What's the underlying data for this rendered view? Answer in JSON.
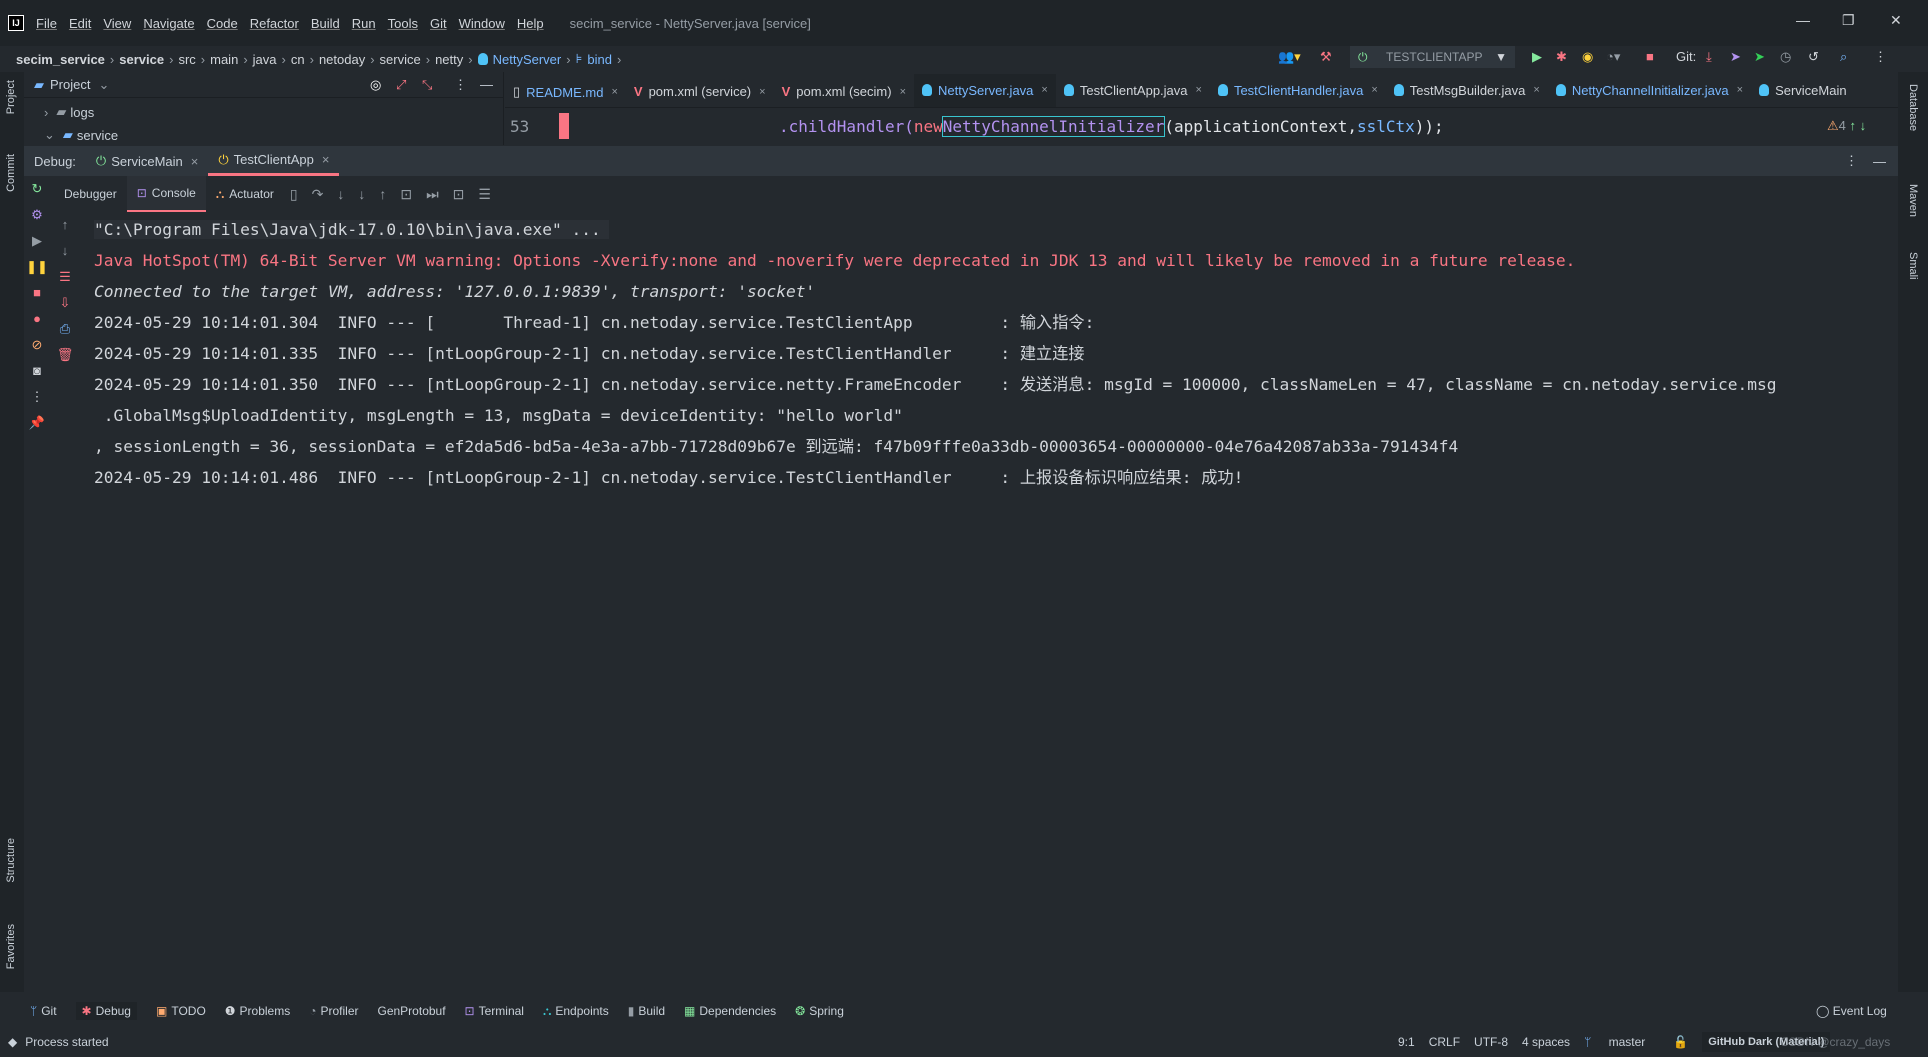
{
  "menubar": {
    "items": [
      "File",
      "Edit",
      "View",
      "Navigate",
      "Code",
      "Refactor",
      "Build",
      "Run",
      "Tools",
      "Git",
      "Window",
      "Help"
    ],
    "window_title": "secim_service - NettyServer.java [service]"
  },
  "breadcrumb": [
    "secim_service",
    "service",
    "src",
    "main",
    "java",
    "cn",
    "netoday",
    "service",
    "netty",
    "NettyServer",
    "bind"
  ],
  "toolbar": {
    "run_config": "TESTCLIENTAPP",
    "git_label": "Git:"
  },
  "project": {
    "title": "Project",
    "items": [
      "logs",
      "service"
    ]
  },
  "editor": {
    "tabs": [
      {
        "label": "README.md",
        "icon": "markdown-icon"
      },
      {
        "label": "pom.xml (service)",
        "icon": "maven-icon"
      },
      {
        "label": "pom.xml (secim)",
        "icon": "maven-icon"
      },
      {
        "label": "NettyServer.java",
        "icon": "java-class-icon",
        "selected": true
      },
      {
        "label": "TestClientApp.java",
        "icon": "java-class-icon"
      },
      {
        "label": "TestClientHandler.java",
        "icon": "java-class-icon"
      },
      {
        "label": "TestMsgBuilder.java",
        "icon": "java-class-icon"
      },
      {
        "label": "NettyChannelInitializer.java",
        "icon": "java-class-icon"
      },
      {
        "label": "ServiceMain",
        "icon": "java-class-icon"
      }
    ],
    "line_number": "53",
    "code_pre": ".childHandler(",
    "code_new": "new ",
    "code_cls": "NettyChannelInitializer",
    "code_args1": "(applicationContext, ",
    "code_args2": "sslCtx",
    "code_end": "));",
    "warnings": "4"
  },
  "debug": {
    "label": "Debug:",
    "sessions": [
      {
        "label": "ServiceMain"
      },
      {
        "label": "TestClientApp",
        "selected": true
      }
    ],
    "tabs": [
      "Debugger",
      "Console",
      "Actuator"
    ]
  },
  "console": {
    "lines": [
      {
        "text": "\"C:\\Program Files\\Java\\jdk-17.0.10\\bin\\java.exe\" ...",
        "kind": "cmd"
      },
      {
        "text": "Java HotSpot(TM) 64-Bit Server VM warning: Options -Xverify:none and -noverify were deprecated in JDK 13 and will likely be removed in a future release.",
        "kind": "err"
      },
      {
        "text": "Connected to the target VM, address: '127.0.0.1:9839', transport: 'socket'",
        "kind": "it"
      },
      {
        "text": "2024-05-29 10:14:01.304  INFO --- [       Thread-1] cn.netoday.service.TestClientApp         : 输入指令:",
        "kind": "out"
      },
      {
        "text": "2024-05-29 10:14:01.335  INFO --- [ntLoopGroup-2-1] cn.netoday.service.TestClientHandler     : 建立连接",
        "kind": "out"
      },
      {
        "text": "2024-05-29 10:14:01.350  INFO --- [ntLoopGroup-2-1] cn.netoday.service.netty.FrameEncoder    : 发送消息: msgId = 100000, classNameLen = 47, className = cn.netoday.service.msg",
        "kind": "out"
      },
      {
        "text": " .GlobalMsg$UploadIdentity, msgLength = 13, msgData = deviceIdentity: \"hello world\"",
        "kind": "out"
      },
      {
        "text": ", sessionLength = 36, sessionData = ef2da5d6-bd5a-4e3a-a7bb-71728d09b67e 到远端: f47b09fffe0a33db-00003654-00000000-04e76a42087ab33a-791434f4",
        "kind": "out"
      },
      {
        "text": "2024-05-29 10:14:01.486  INFO --- [ntLoopGroup-2-1] cn.netoday.service.TestClientHandler     : 上报设备标识响应结果: 成功!",
        "kind": "out"
      }
    ]
  },
  "left_stripe": [
    "Project",
    "Commit",
    "Structure",
    "Favorites"
  ],
  "right_stripe": [
    "Database",
    "Maven",
    "Smali"
  ],
  "bottom_tabs": [
    "Git",
    "Debug",
    "TODO",
    "Problems",
    "Profiler",
    "GenProtobuf",
    "Terminal",
    "Endpoints",
    "Build",
    "Dependencies",
    "Spring"
  ],
  "event_log": "Event Log",
  "status": {
    "message": "Process started",
    "position": "9:1",
    "line_sep": "CRLF",
    "encoding": "UTF-8",
    "indent": "4 spaces",
    "branch": "master",
    "theme": "GitHub Dark (Material)",
    "watermark": "CSDN @crazy_days"
  },
  "colors": {
    "accent": "#f97583",
    "link": "#79b8ff",
    "background": "#24292e"
  }
}
